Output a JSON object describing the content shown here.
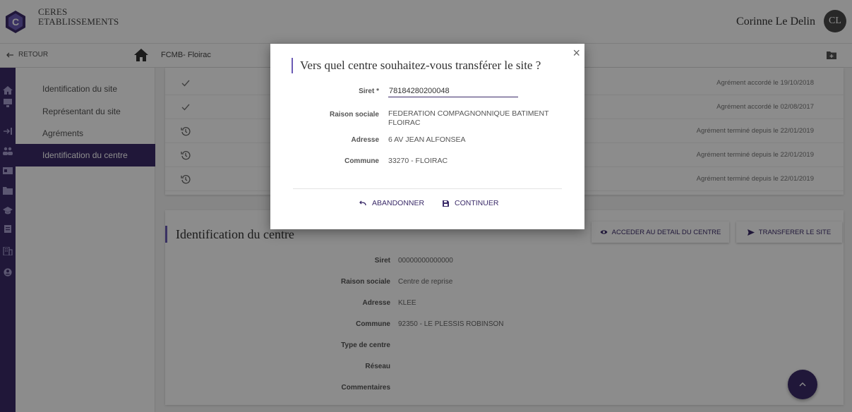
{
  "app": {
    "title_line1": "CERES",
    "title_line2": "ETABLISSEMENTS"
  },
  "user": {
    "name": "Corinne Le Delin",
    "initials": "CL"
  },
  "subbar": {
    "back_label": "RETOUR",
    "breadcrumb": "FCMB- Floirac"
  },
  "sidenav": {
    "items": [
      {
        "label": "Identification du site"
      },
      {
        "label": "Représentant du site"
      },
      {
        "label": "Agréments"
      },
      {
        "label": "Identification du centre"
      }
    ]
  },
  "agrements": [
    {
      "icon": "check-icon",
      "status": "Agrément accordé le 19/10/2018"
    },
    {
      "icon": "check-icon",
      "status": "Agrément accordé le 02/08/2017"
    },
    {
      "icon": "history-icon",
      "status": "Agrément terminé depuis le 22/01/2019"
    },
    {
      "icon": "history-icon",
      "status": "Agrément terminé depuis le 22/01/2019"
    },
    {
      "icon": "history-icon",
      "status": "Agrément terminé depuis le 22/01/2019"
    }
  ],
  "centre": {
    "title": "Identification du centre",
    "btn_detail": "ACCEDER AU DETAIL DU CENTRE",
    "btn_transfer": "TRANSFERER LE SITE",
    "fields": [
      {
        "label": "Siret",
        "value": "00000000000000"
      },
      {
        "label": "Raison sociale",
        "value": "Centre de reprise"
      },
      {
        "label": "Adresse",
        "value": "KLEE"
      },
      {
        "label": "Commune",
        "value": "92350 - LE PLESSIS ROBINSON"
      },
      {
        "label": "Type de centre",
        "value": ""
      },
      {
        "label": "Réseau",
        "value": ""
      },
      {
        "label": "Commentaires",
        "value": ""
      }
    ]
  },
  "modal": {
    "title": "Vers quel centre souhaitez-vous transférer le site ?",
    "close": "×",
    "siret_label": "Siret *",
    "siret_value": "78184280200048",
    "raison_label": "Raison sociale",
    "raison_value": "FEDERATION COMPAGNONNIQUE BATIMENT FLOIRAC",
    "adresse_label": "Adresse",
    "adresse_value": "6 AV JEAN ALFONSEA",
    "commune_label": "Commune",
    "commune_value": "33270 - FLOIRAC",
    "cancel_label": "ABANDONNER",
    "continue_label": "CONTINUER"
  },
  "colors": {
    "primary": "#3b2b69",
    "accent": "#6b5bb5"
  }
}
